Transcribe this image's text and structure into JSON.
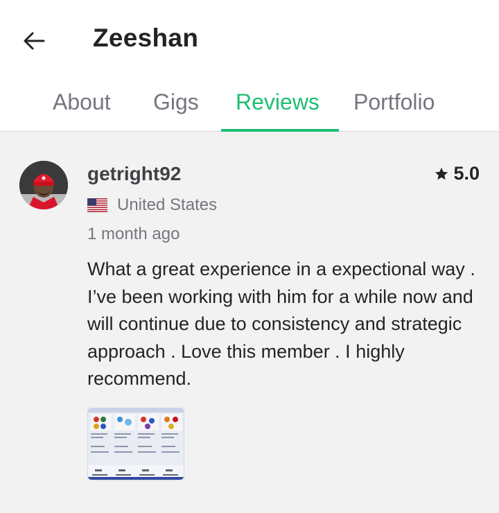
{
  "header": {
    "back_icon": "arrow-left-icon",
    "title": "Zeeshan"
  },
  "tabs": [
    {
      "label": "About",
      "active": false
    },
    {
      "label": "Gigs",
      "active": false
    },
    {
      "label": "Reviews",
      "active": true
    },
    {
      "label": "Portfolio",
      "active": false
    }
  ],
  "review": {
    "username": "getright92",
    "rating": "5.0",
    "rating_icon": "star-icon",
    "country_flag_icon": "us-flag-icon",
    "country": "United States",
    "time_ago": "1 month ago",
    "text": "What a great experience in a expectional way . I’ve been working with him for a while now and will continue due to consistency and strategic approach . Love this member . I highly recommend.",
    "attachment_icon": "image-thumbnail"
  },
  "colors": {
    "accent": "#1dbf73",
    "text_primary": "#222325",
    "text_secondary": "#74767e",
    "background": "#f2f2f2"
  }
}
